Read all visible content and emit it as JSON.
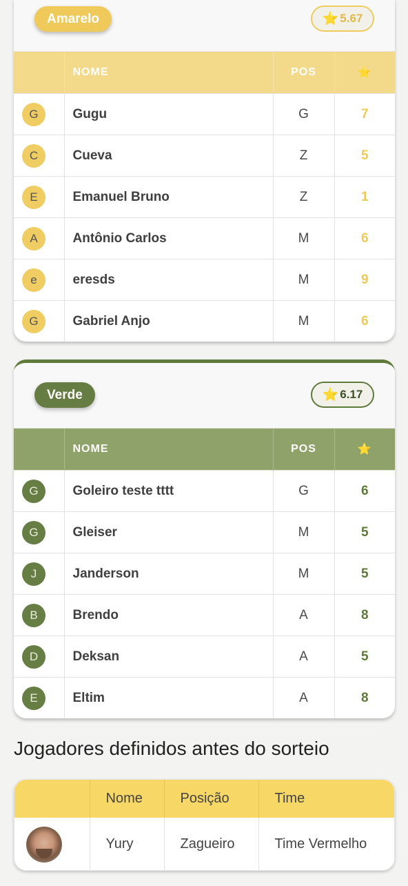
{
  "teams": [
    {
      "name": "Amarelo",
      "score": "5.67",
      "columns": {
        "name": "NOME",
        "pos": "POS"
      },
      "players": [
        {
          "initial": "G",
          "name": "Gugu",
          "pos": "G",
          "rating": "7"
        },
        {
          "initial": "C",
          "name": "Cueva",
          "pos": "Z",
          "rating": "5"
        },
        {
          "initial": "E",
          "name": "Emanuel Bruno",
          "pos": "Z",
          "rating": "1"
        },
        {
          "initial": "A",
          "name": "Antônio Carlos",
          "pos": "M",
          "rating": "6"
        },
        {
          "initial": "e",
          "name": "eresds",
          "pos": "M",
          "rating": "9"
        },
        {
          "initial": "G",
          "name": "Gabriel Anjo",
          "pos": "M",
          "rating": "6"
        }
      ],
      "accent": "#efc95a"
    },
    {
      "name": "Verde",
      "score": "6.17",
      "columns": {
        "name": "NOME",
        "pos": "POS"
      },
      "players": [
        {
          "initial": "G",
          "name": "Goleiro teste tttt",
          "pos": "G",
          "rating": "6"
        },
        {
          "initial": "G",
          "name": "Gleiser",
          "pos": "M",
          "rating": "5"
        },
        {
          "initial": "J",
          "name": "Janderson",
          "pos": "M",
          "rating": "5"
        },
        {
          "initial": "B",
          "name": "Brendo",
          "pos": "A",
          "rating": "8"
        },
        {
          "initial": "D",
          "name": "Deksan",
          "pos": "A",
          "rating": "5"
        },
        {
          "initial": "E",
          "name": "Eltim",
          "pos": "A",
          "rating": "8"
        }
      ],
      "accent": "#657c42"
    }
  ],
  "star_icon": "star-icon",
  "predefined": {
    "title": "Jogadores definidos antes do sorteio",
    "headers": {
      "name": "Nome",
      "position": "Posição",
      "team": "Time"
    },
    "rows": [
      {
        "name": "Yury",
        "position": "Zagueiro",
        "team": "Time Vermelho",
        "avatar": "user-photo"
      }
    ],
    "header_color": "#f7d766"
  }
}
